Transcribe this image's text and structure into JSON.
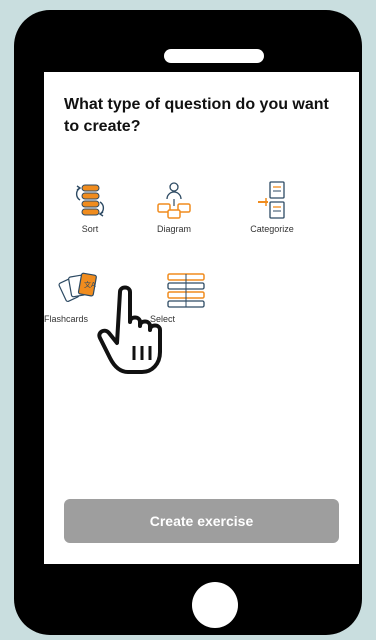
{
  "question": "What type of question do you want to create?",
  "options": [
    {
      "label": "Sort",
      "icon": "sort-icon"
    },
    {
      "label": "Diagram",
      "icon": "diagram-icon"
    },
    {
      "label": "Categorize",
      "icon": "categorize-icon"
    },
    {
      "label": "Flashcards",
      "icon": "flashcards-icon"
    },
    {
      "label": "Select",
      "icon": "select-icon"
    }
  ],
  "create_button": {
    "label": "Create exercise",
    "state": "disabled"
  },
  "colors": {
    "accent": "#f08c1e",
    "icon_stroke": "#2d4a63",
    "button_disabled": "#9e9e9e",
    "background": "#c9dedf"
  },
  "overlay": {
    "icon": "pointing-hand-icon"
  }
}
